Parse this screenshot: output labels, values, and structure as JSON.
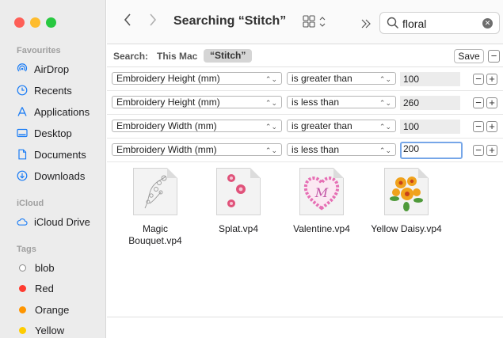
{
  "window": {
    "traffic_lights": {
      "close": "#fe5f57",
      "minimize": "#febc2e",
      "zoom": "#28c840"
    }
  },
  "sidebar": {
    "favourites_label": "Favourites",
    "favourites": [
      {
        "label": "AirDrop",
        "icon": "airdrop-icon"
      },
      {
        "label": "Recents",
        "icon": "clock-icon"
      },
      {
        "label": "Applications",
        "icon": "applications-icon"
      },
      {
        "label": "Desktop",
        "icon": "desktop-icon"
      },
      {
        "label": "Documents",
        "icon": "document-icon"
      },
      {
        "label": "Downloads",
        "icon": "download-icon"
      }
    ],
    "icloud_label": "iCloud",
    "icloud": [
      {
        "label": "iCloud Drive",
        "icon": "cloud-icon"
      }
    ],
    "tags_label": "Tags",
    "tags": [
      {
        "label": "blob",
        "color": "#ffffff"
      },
      {
        "label": "Red",
        "color": "#fe3b30"
      },
      {
        "label": "Orange",
        "color": "#fe9500"
      },
      {
        "label": "Yellow",
        "color": "#fecc00"
      }
    ],
    "accent": "#1a7cf5"
  },
  "toolbar": {
    "title": "Searching “Stitch”",
    "search_value": "floral"
  },
  "scope": {
    "label": "Search:",
    "this_mac": "This Mac",
    "selected": "“Stitch”",
    "save_label": "Save"
  },
  "criteria": [
    {
      "attribute": "Embroidery Height (mm)",
      "operator": "is greater than",
      "value": "100"
    },
    {
      "attribute": "Embroidery Height (mm)",
      "operator": "is less than",
      "value": "260"
    },
    {
      "attribute": "Embroidery Width (mm)",
      "operator": "is greater than",
      "value": "100"
    },
    {
      "attribute": "Embroidery Width (mm)",
      "operator": "is less than",
      "value": "200"
    }
  ],
  "results": [
    {
      "line1": "Magic",
      "line2": "Bouquet.vp4"
    },
    {
      "line1": "Splat.vp4",
      "line2": ""
    },
    {
      "line1": "Valentine.vp4",
      "line2": ""
    },
    {
      "line1": "Yellow Daisy.vp4",
      "line2": ""
    }
  ]
}
